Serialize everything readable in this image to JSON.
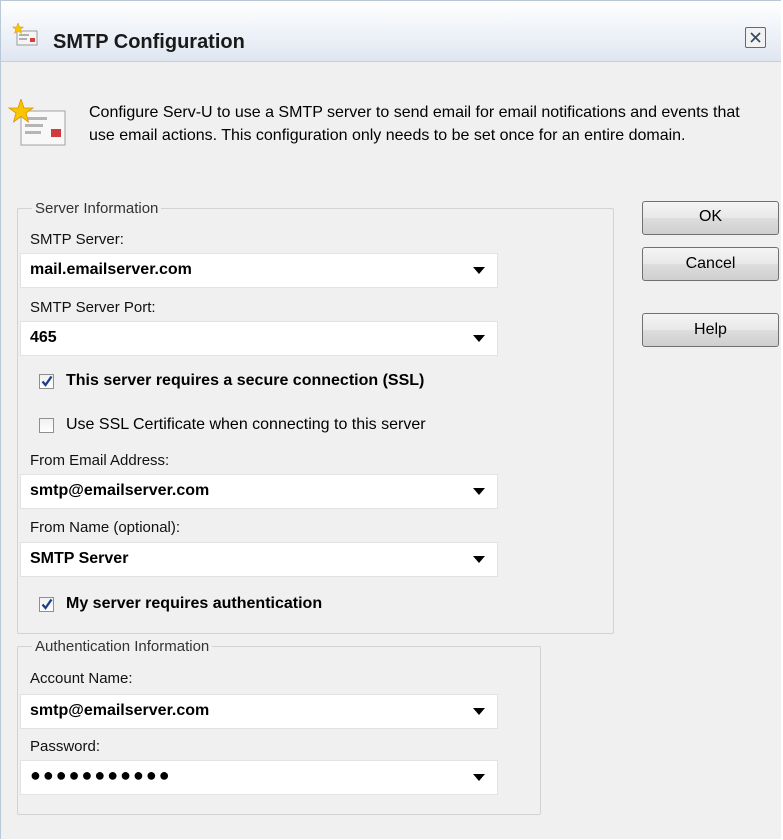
{
  "dialog": {
    "title": "SMTP Configuration",
    "intro_text": "Configure Serv-U to use a SMTP server to send email for email notifications and events that use email actions. This configuration only needs to be set once for an entire domain."
  },
  "server_info": {
    "legend": "Server Information",
    "smtp_server": {
      "label": "SMTP Server:",
      "value": "mail.emailserver.com"
    },
    "smtp_port": {
      "label": "SMTP Server Port:",
      "value": "465"
    },
    "ssl_checkbox": {
      "label": "This server requires a secure connection (SSL)",
      "checked": true
    },
    "cert_checkbox": {
      "label": "Use SSL Certificate when connecting to this server",
      "checked": false
    },
    "from_email": {
      "label": "From Email Address:",
      "value": "smtp@emailserver.com"
    },
    "from_name": {
      "label": "From Name (optional):",
      "value": "SMTP Server"
    },
    "auth_checkbox": {
      "label": "My server requires authentication",
      "checked": true
    }
  },
  "auth_info": {
    "legend": "Authentication Information",
    "account_name": {
      "label": "Account Name:",
      "value": "smtp@emailserver.com"
    },
    "password": {
      "label": "Password:",
      "value": "●●●●●●●●●●●"
    }
  },
  "buttons": {
    "ok": "OK",
    "cancel": "Cancel",
    "help": "Help"
  },
  "icons": {
    "title": "new-mail-icon",
    "intro": "new-mail-icon",
    "close": "close-icon",
    "dropdown": "chevron-down-icon",
    "check": "checkmark-icon"
  }
}
